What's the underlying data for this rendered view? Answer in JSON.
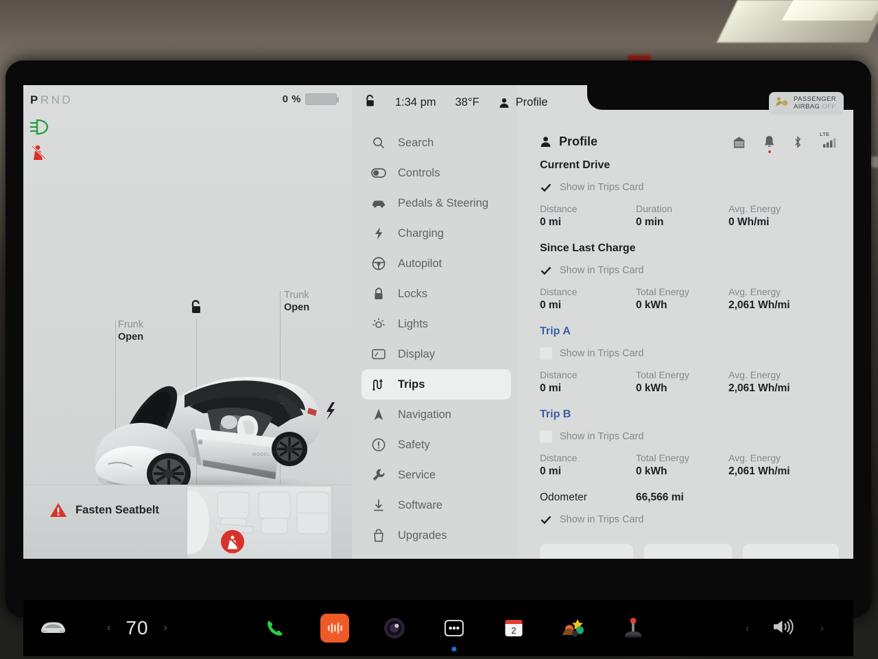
{
  "drive_panel": {
    "gear": {
      "letters": [
        "P",
        "R",
        "N",
        "D"
      ],
      "active": "P"
    },
    "battery": {
      "percent": "0 %"
    },
    "telltales": [
      {
        "name": "low-beam-headlight",
        "color": "#1f9e3e"
      },
      {
        "name": "seatbelt-warning",
        "color": "#d8322a"
      }
    ],
    "callouts": [
      {
        "title": "Frunk",
        "state": "Open"
      },
      {
        "title": "Trunk",
        "state": "Open"
      }
    ],
    "page_dots": {
      "count": 3,
      "active_index": 0
    },
    "warning": {
      "text": "Fasten Seatbelt",
      "icon": "warning-triangle-icon",
      "color": "#d8322a"
    }
  },
  "status_bar": {
    "lock_icon": "unlocked-padlock-icon",
    "time": "1:34 pm",
    "temperature": "38°F",
    "profile_label": "Profile",
    "airbag": {
      "line1": "PASSENGER",
      "line2": "AIRBAG",
      "state": "OFF"
    }
  },
  "nav": {
    "items": [
      {
        "label": "Search",
        "icon": "search-icon",
        "selected": false
      },
      {
        "label": "Controls",
        "icon": "toggle-switch-icon",
        "selected": false
      },
      {
        "label": "Pedals & Steering",
        "icon": "car-side-icon",
        "selected": false
      },
      {
        "label": "Charging",
        "icon": "lightning-bolt-icon",
        "selected": false
      },
      {
        "label": "Autopilot",
        "icon": "steering-wheel-icon",
        "selected": false
      },
      {
        "label": "Locks",
        "icon": "padlock-icon",
        "selected": false
      },
      {
        "label": "Lights",
        "icon": "headlight-sun-icon",
        "selected": false
      },
      {
        "label": "Display",
        "icon": "display-screen-icon",
        "selected": false
      },
      {
        "label": "Trips",
        "icon": "winding-road-icon",
        "selected": true
      },
      {
        "label": "Navigation",
        "icon": "navigation-arrow-icon",
        "selected": false
      },
      {
        "label": "Safety",
        "icon": "exclamation-circle-icon",
        "selected": false
      },
      {
        "label": "Service",
        "icon": "wrench-icon",
        "selected": false
      },
      {
        "label": "Software",
        "icon": "download-arrow-icon",
        "selected": false
      },
      {
        "label": "Upgrades",
        "icon": "shopping-bag-icon",
        "selected": false
      }
    ]
  },
  "content": {
    "header": {
      "title": "Profile",
      "icons": [
        "garage-home-icon",
        "bell-icon",
        "bluetooth-icon",
        "lte-signal-icon"
      ],
      "lte_label": "LTE"
    },
    "checkbox_label": "Show in Trips Card",
    "sections": [
      {
        "title": "Current Drive",
        "is_link": false,
        "checked": true,
        "stats": [
          {
            "label": "Distance",
            "value": "0 mi"
          },
          {
            "label": "Duration",
            "value": "0 min"
          },
          {
            "label": "Avg. Energy",
            "value": "0 Wh/mi"
          }
        ]
      },
      {
        "title": "Since Last Charge",
        "is_link": false,
        "checked": true,
        "stats": [
          {
            "label": "Distance",
            "value": "0 mi"
          },
          {
            "label": "Total Energy",
            "value": "0 kWh"
          },
          {
            "label": "Avg. Energy",
            "value": "2,061 Wh/mi"
          }
        ]
      },
      {
        "title": "Trip A",
        "is_link": true,
        "checked": false,
        "stats": [
          {
            "label": "Distance",
            "value": "0 mi"
          },
          {
            "label": "Total Energy",
            "value": "0 kWh"
          },
          {
            "label": "Avg. Energy",
            "value": "2,061 Wh/mi"
          }
        ]
      },
      {
        "title": "Trip B",
        "is_link": true,
        "checked": false,
        "stats": [
          {
            "label": "Distance",
            "value": "0 mi"
          },
          {
            "label": "Total Energy",
            "value": "0 kWh"
          },
          {
            "label": "Avg. Energy",
            "value": "2,061 Wh/mi"
          }
        ]
      }
    ],
    "odometer": {
      "label": "Odometer",
      "value": "66,566 mi",
      "checked": true
    }
  },
  "taskbar": {
    "car_icon": "car-front-icon",
    "temperature": "70",
    "prev_icon": "chevron-left-icon",
    "next_icon": "chevron-right-icon",
    "apps": [
      {
        "name": "phone-icon",
        "badge": false
      },
      {
        "name": "media-waveform-icon",
        "badge": false
      },
      {
        "name": "camera-icon",
        "badge": false
      },
      {
        "name": "toybox-dots-icon",
        "badge": true
      },
      {
        "name": "calendar-icon",
        "badge": false,
        "day": "2"
      },
      {
        "name": "arcade-icon",
        "badge": true
      },
      {
        "name": "joystick-icon",
        "badge": false
      }
    ],
    "volume_icon": "speaker-volume-icon"
  },
  "colors": {
    "screen_bg": "#d9dbdb",
    "link_blue": "#3a5fa8",
    "warning_red": "#d8322a",
    "telltale_green": "#1f9e3e",
    "badge_blue": "#1f6fe0"
  }
}
